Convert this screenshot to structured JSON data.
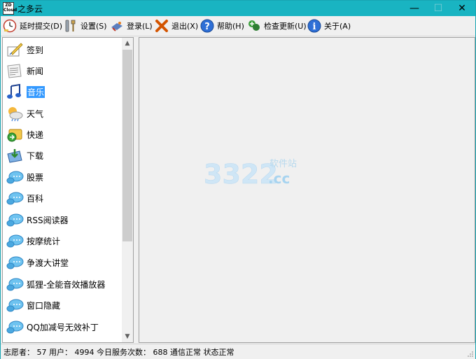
{
  "window": {
    "title": "之多云",
    "app_icon_lines": [
      "ZD",
      "Cloud"
    ],
    "controls": {
      "minimize": "—",
      "maximize": "☐",
      "close": "✕"
    }
  },
  "toolbar": {
    "buttons": [
      {
        "label": "延时提交(D)",
        "icon": "clock-icon"
      },
      {
        "label": "设置(S)",
        "icon": "wrench-icon"
      },
      {
        "label": "登录(L)",
        "icon": "login-icon"
      },
      {
        "label": "退出(X)",
        "icon": "exit-x-icon"
      },
      {
        "label": "帮助(H)",
        "icon": "help-icon"
      },
      {
        "label": "检查更新(U)",
        "icon": "update-icon"
      },
      {
        "label": "关于(A)",
        "icon": "info-icon"
      }
    ]
  },
  "sidebar": {
    "selected_index": 2,
    "items": [
      {
        "label": "签到",
        "icon": "sign-pen-icon"
      },
      {
        "label": "新闻",
        "icon": "news-icon"
      },
      {
        "label": "音乐",
        "icon": "music-icon"
      },
      {
        "label": "天气",
        "icon": "weather-icon"
      },
      {
        "label": "快递",
        "icon": "express-icon"
      },
      {
        "label": "下载",
        "icon": "download-icon"
      },
      {
        "label": "股票",
        "icon": "plugin-icon"
      },
      {
        "label": "百科",
        "icon": "plugin-icon"
      },
      {
        "label": "RSS阅读器",
        "icon": "plugin-icon"
      },
      {
        "label": "按摩统计",
        "icon": "plugin-icon"
      },
      {
        "label": "争渡大讲堂",
        "icon": "plugin-icon"
      },
      {
        "label": "狐狸-全能音效播放器",
        "icon": "plugin-icon"
      },
      {
        "label": "窗口隐藏",
        "icon": "plugin-icon"
      },
      {
        "label": "QQ加减号无效补丁",
        "icon": "plugin-icon"
      }
    ],
    "scroll_up": "▲",
    "scroll_down": "▼"
  },
  "watermark": {
    "number": "3322",
    "tld": ".cc",
    "site": "软件站"
  },
  "status": {
    "text": "志愿者： 57 用户： 4994 今日服务次数： 688  通信正常  状态正常"
  },
  "colors": {
    "titlebar": "#19b4c2",
    "selection": "#3399ff"
  }
}
